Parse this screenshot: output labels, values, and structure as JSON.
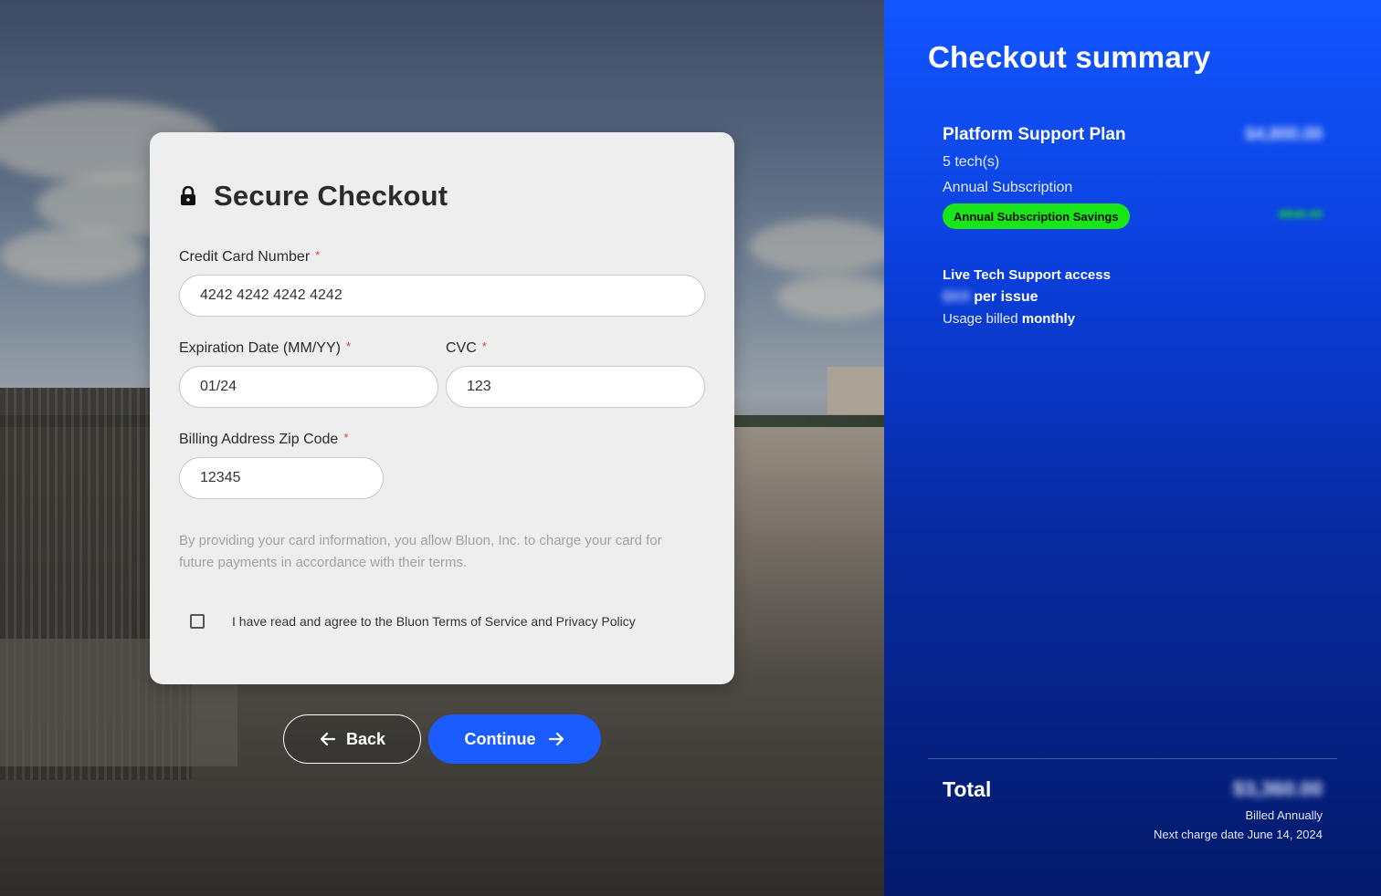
{
  "checkout": {
    "title": "Secure Checkout",
    "lock_icon": "lock-icon",
    "card_number_label": "Credit Card Number",
    "card_number_value": "4242 4242 4242 4242",
    "expiration_label": "Expiration Date (MM/YY)",
    "expiration_value": "01/24",
    "cvc_label": "CVC",
    "cvc_value": "123",
    "zip_label": "Billing Address Zip Code",
    "zip_value": "12345",
    "required_marker": "*",
    "disclaimer": "By providing your card information, you allow Bluon, Inc. to charge your card for future payments in accordance with their terms.",
    "agree_label": "I have read and agree to the Bluon Terms of Service and Privacy Policy",
    "agree_checked": false
  },
  "actions": {
    "back_label": "Back",
    "continue_label": "Continue",
    "back_icon": "arrow-left-icon",
    "continue_icon": "arrow-right-icon"
  },
  "summary": {
    "title": "Checkout summary",
    "plan_name": "Platform Support Plan",
    "plan_price": "$4,800.00",
    "techs": "5 tech(s)",
    "subscription": "Annual Subscription",
    "savings_badge": "Annual Subscription Savings",
    "savings_amount": "-$840.00",
    "support_title": "Live Tech Support access",
    "support_price": "$XX",
    "support_per": "per issue",
    "usage_prefix": "Usage billed",
    "usage_period": "monthly",
    "total_label": "Total",
    "total_amount": "$3,360.00",
    "billed": "Billed Annually",
    "next_charge": "Next charge date June 14, 2024"
  },
  "colors": {
    "accent": "#1a5cff",
    "badge_green": "#19e619",
    "required_red": "#e53935",
    "panel_top": "#1256ff",
    "panel_bottom": "#031a6a"
  }
}
